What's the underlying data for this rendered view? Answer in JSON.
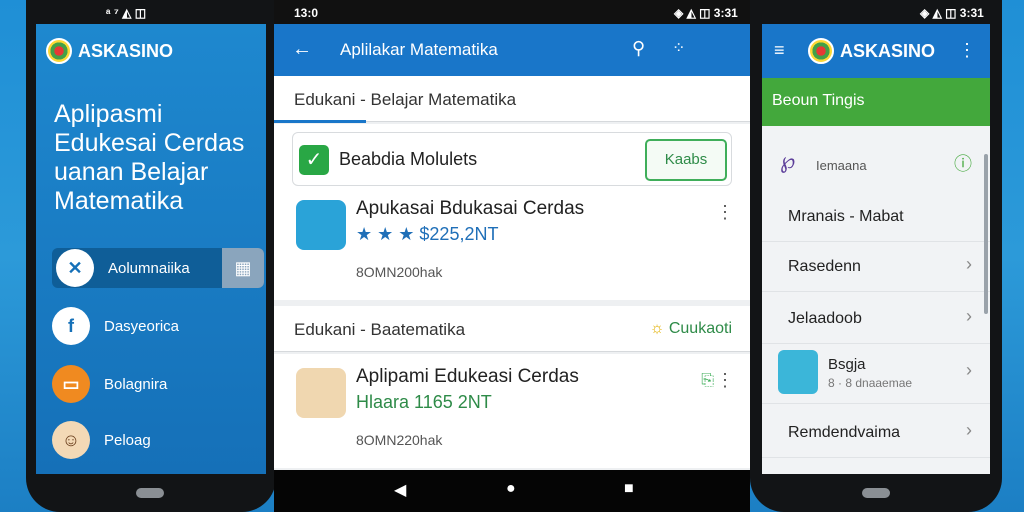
{
  "left": {
    "status": "ᵃ ⁷ ◭ ◫",
    "brand": "ASKASINO",
    "hero": "Aplipasmi Edukesai Cerdas uanan Belajar Matematika",
    "menu": [
      {
        "label": "Aolumnaiika",
        "icon": "✕"
      },
      {
        "label": "Dasyeorica",
        "icon": "f"
      },
      {
        "label": "Bolagnira",
        "icon": "▭"
      },
      {
        "label": "Peloag",
        "icon": "☺"
      }
    ]
  },
  "mid": {
    "status_time": "13:0",
    "status_right": "◈ ◭ ◫ 3:31",
    "appbar_title": "Aplilakar Matematika",
    "section1": "Edukani - Belajar Matematika",
    "feature": {
      "label": "Beabdia Molulets",
      "button": "Kaabs"
    },
    "apps": [
      {
        "name": "Apukasai Bdukasai Cerdas",
        "rating": "★ ★ ★ $225,2NT",
        "size": "8OMN200hak"
      },
      {
        "name": "Aplipami Edukeasi Cerdas",
        "rating": "Hlaara 1165 2NT",
        "size": "8OMN220hak"
      }
    ],
    "section2": "Edukani - Baatematika",
    "section2_action": "Cuukaoti",
    "nav": {
      "back": "◀",
      "home": "●",
      "recent": "■"
    }
  },
  "right": {
    "status": "◈ ◭ ◫ 3:31",
    "brand": "ASKASINO",
    "green": "Beoun Tingis",
    "header_item": "Iemaana",
    "items": [
      "Mranais - Mabat",
      "Rasedenn",
      "Jelaadoob",
      "Remdendvaima"
    ],
    "bseja": {
      "title": "Bsgja",
      "sub": "8 · 8 dnaaemae"
    }
  },
  "colors": {
    "primary": "#1976c9",
    "green": "#43a83c"
  }
}
